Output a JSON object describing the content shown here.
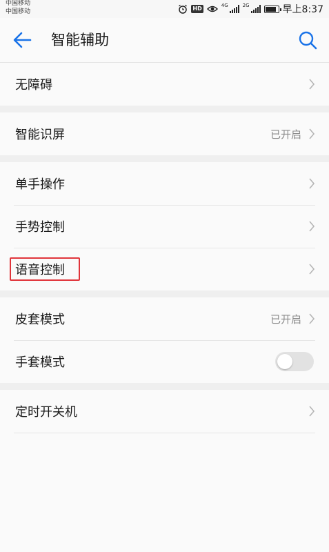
{
  "status_bar": {
    "carrier1": "中国移动",
    "carrier2": "中国移动",
    "hd": "HD",
    "net1": "4G",
    "net2": "2G",
    "time": "早上8:37",
    "icons": [
      "alarm-icon",
      "eye-icon",
      "signal-icon",
      "battery-icon"
    ]
  },
  "header": {
    "title": "智能辅助",
    "back_icon": "arrow-left-icon",
    "search_icon": "search-icon",
    "accent": "#1a73e8"
  },
  "groups": [
    {
      "items": [
        {
          "label": "无障碍",
          "value": "",
          "control": "chevron"
        }
      ]
    },
    {
      "items": [
        {
          "label": "智能识屏",
          "value": "已开启",
          "control": "chevron"
        }
      ]
    },
    {
      "items": [
        {
          "label": "单手操作",
          "value": "",
          "control": "chevron"
        },
        {
          "label": "手势控制",
          "value": "",
          "control": "chevron"
        },
        {
          "label": "语音控制",
          "value": "",
          "control": "chevron",
          "highlighted": true
        }
      ]
    },
    {
      "items": [
        {
          "label": "皮套模式",
          "value": "已开启",
          "control": "chevron"
        },
        {
          "label": "手套模式",
          "value": "",
          "control": "toggle",
          "toggle_on": false
        }
      ]
    },
    {
      "items": [
        {
          "label": "定时开关机",
          "value": "",
          "control": "chevron"
        }
      ]
    }
  ],
  "highlight_color": "#e0343a"
}
